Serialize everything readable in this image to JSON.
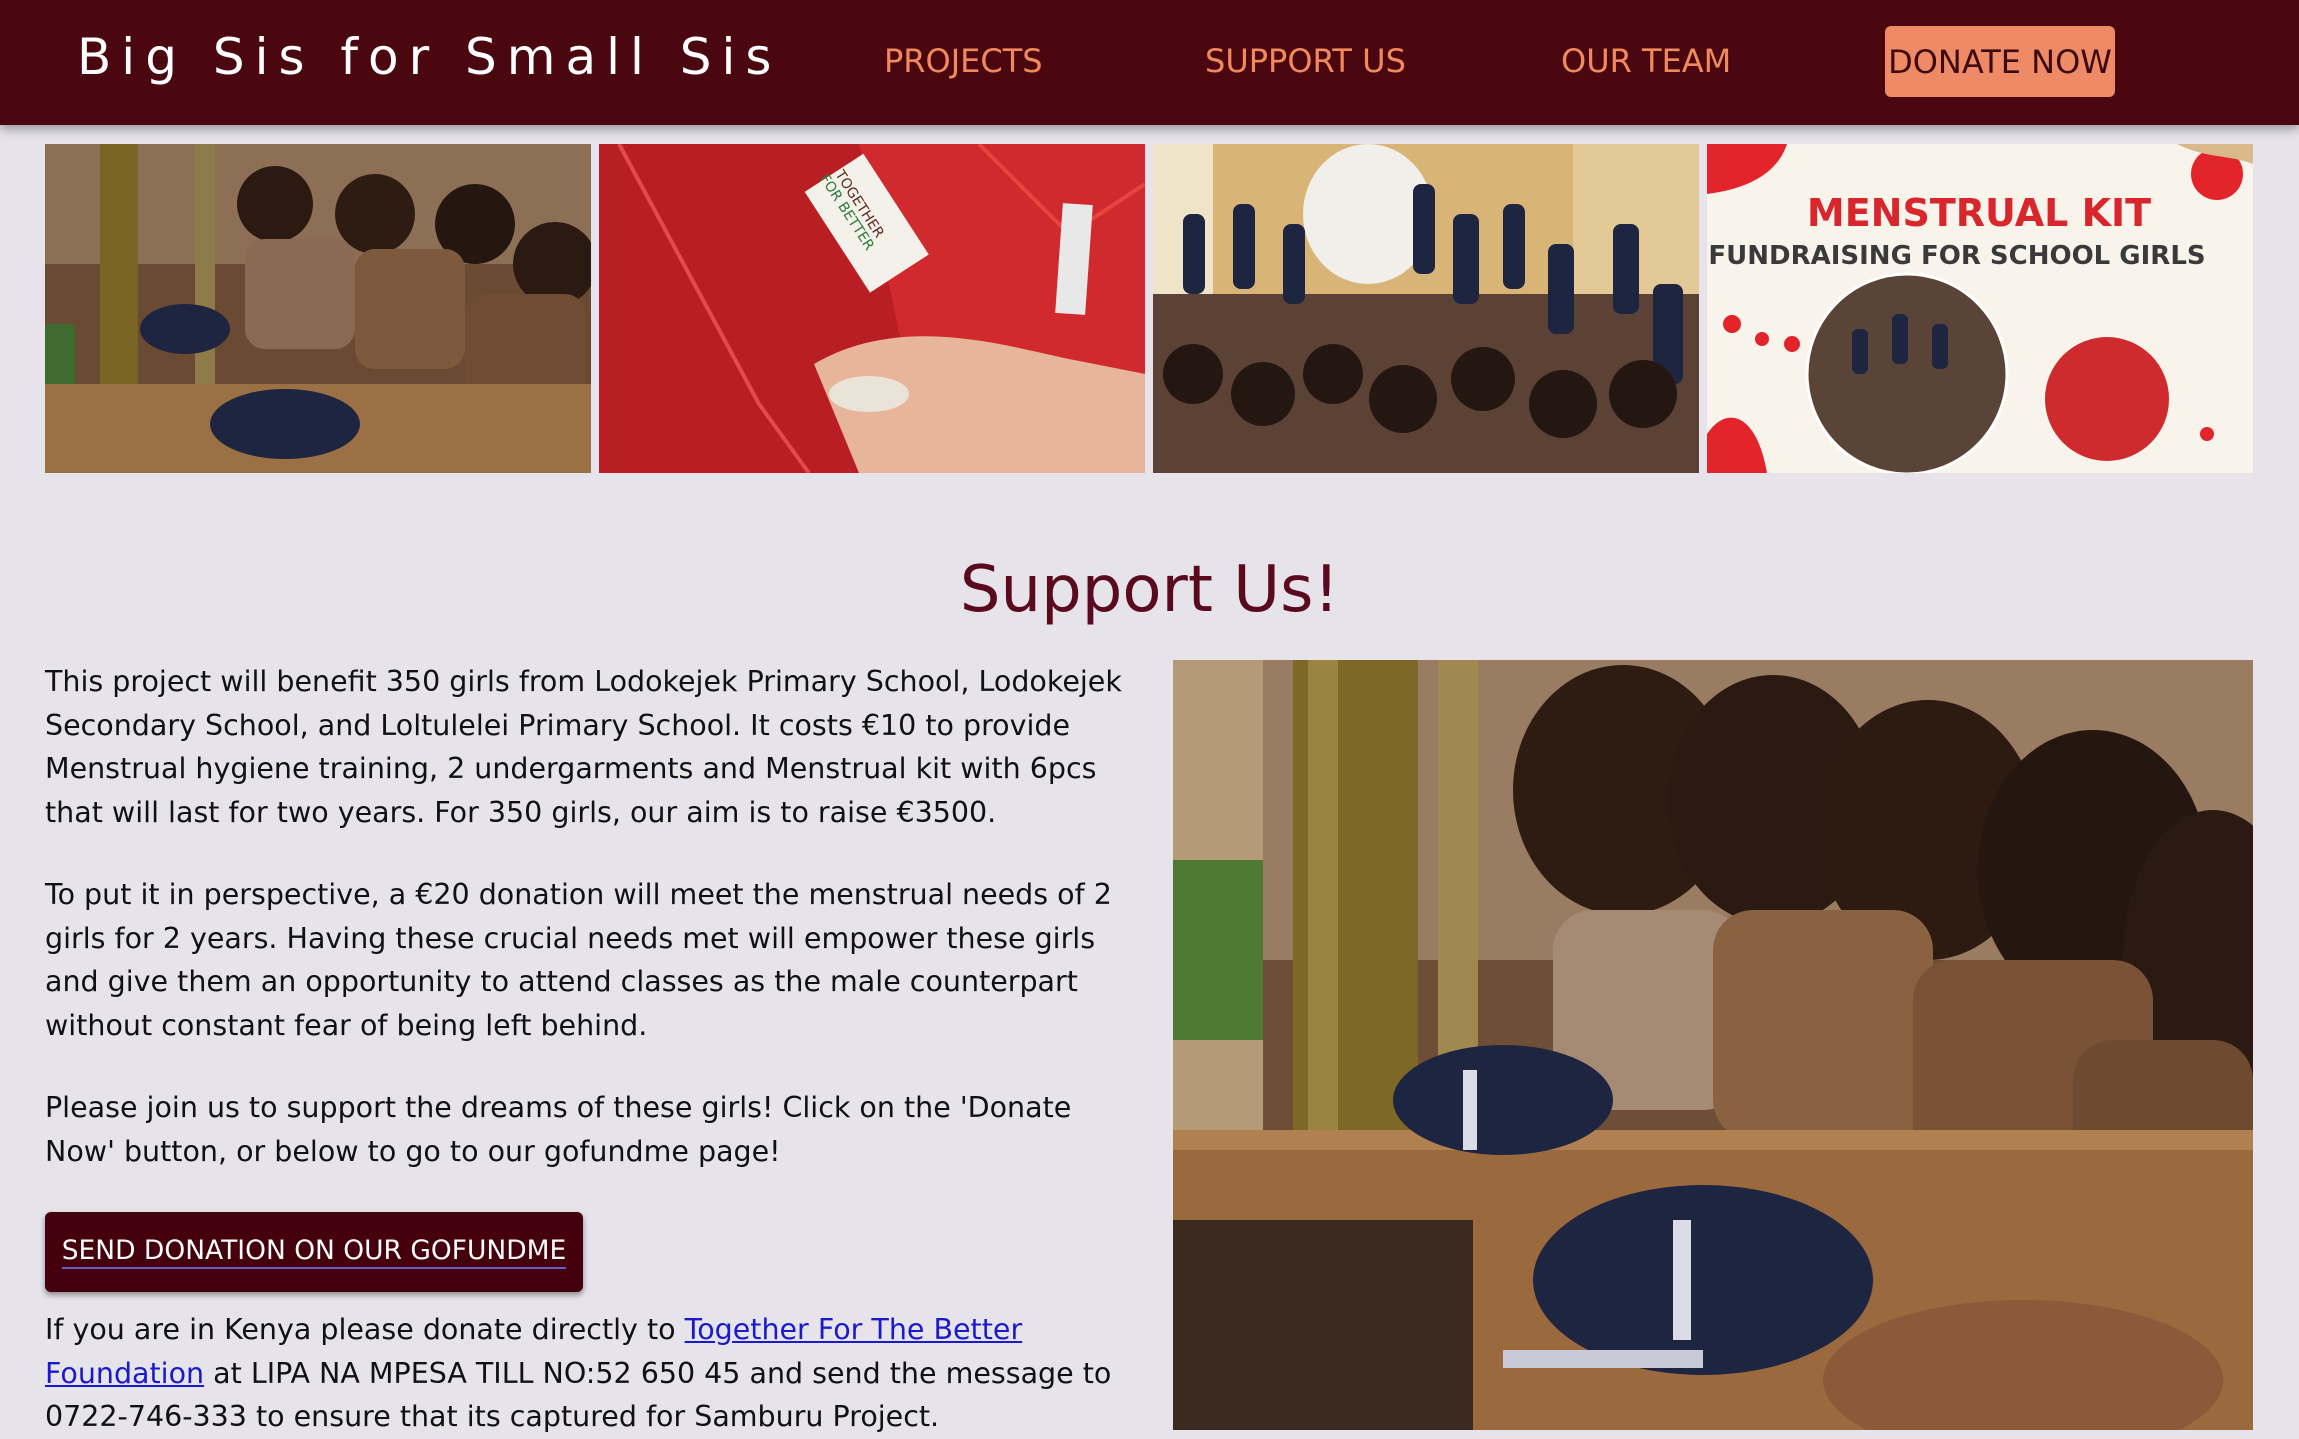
{
  "header": {
    "brand": "Big Sis for Small Sis",
    "nav": [
      "PROJECTS",
      "SUPPORT US",
      "OUR TEAM"
    ],
    "donate_label": "DONATE NOW"
  },
  "gallery": [
    {
      "alt": "Schoolgirls opening menstrual kits at desks"
    },
    {
      "alt": "Red reusable pad with Together For Better label"
    },
    {
      "alt": "Students holding up menstrual kits"
    },
    {
      "alt": "Menstrual kit fundraising poster",
      "poster_title": "MENSTRUAL KIT",
      "poster_subtitle": "FUNDRAISING FOR SCHOOL GIRLS"
    }
  ],
  "tag_text": [
    "TOGETHER",
    "FOR BETTER"
  ],
  "support": {
    "title": "Support Us!",
    "paragraph1": "This project will benefit 350 girls from Lodokejek Primary School, Lodokejek Secondary School, and Loltulelei Primary School. It costs €10 to provide Menstrual hygiene training, 2 undergarments and Menstrual kit with 6pcs that will last for two years. For 350 girls, our aim is to raise €3500.",
    "paragraph2": "To put it in perspective, a €20 donation will meet the menstrual needs of 2 girls for 2 years. Having these crucial needs met will empower these girls and give them an opportunity to attend classes as the male counterpart without constant fear of being left behind.",
    "paragraph3": "Please join us to support the dreams of these girls! Click on the 'Donate Now' button, or below to go to our gofundme page!",
    "gofundme_label": "SEND DONATION ON OUR GOFUNDME",
    "kenya_prefix": "If you are in Kenya please donate directly to ",
    "kenya_link": "Together For The Better Foundation",
    "kenya_suffix": " at LIPA NA MPESA TILL NO:52 650 45 and send the message to 0722-746-333 to ensure that its captured for Samburu Project."
  },
  "colors": {
    "header_bg": "#4b0710",
    "nav_text": "#f08a5d",
    "donate_bg": "#ef8a66",
    "title_color": "#5a0a1e",
    "gofund_bg": "#44000c",
    "page_bg": "#e6e4ea"
  }
}
